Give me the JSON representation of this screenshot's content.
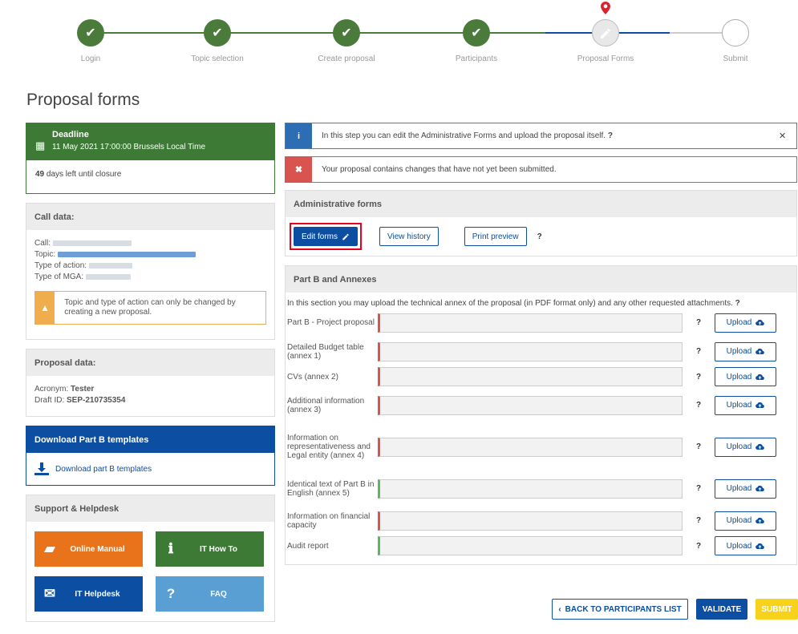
{
  "stepper": {
    "steps": [
      {
        "label": "Login",
        "state": "done"
      },
      {
        "label": "Topic selection",
        "state": "done"
      },
      {
        "label": "Create proposal",
        "state": "done"
      },
      {
        "label": "Participants",
        "state": "done"
      },
      {
        "label": "Proposal Forms",
        "state": "current"
      },
      {
        "label": "Submit",
        "state": "todo"
      }
    ]
  },
  "page_title": "Proposal forms",
  "deadline": {
    "title": "Deadline",
    "date": "11 May 2021 17:00:00 Brussels Local Time",
    "days_count": "49",
    "days_text": "days left until closure"
  },
  "call_data": {
    "title": "Call data:",
    "call_label": "Call:",
    "topic_label": "Topic:",
    "type_action_label": "Type of action:",
    "type_mga_label": "Type of MGA:",
    "warning": "Topic and type of action can only be changed by creating a new proposal."
  },
  "proposal_data": {
    "title": "Proposal data:",
    "acronym_label": "Acronym:",
    "acronym": "Tester",
    "draft_label": "Draft ID:",
    "draft_id": "SEP-210735354"
  },
  "templates": {
    "title": "Download Part B templates",
    "link": "Download part B templates"
  },
  "support": {
    "title": "Support & Helpdesk",
    "buttons": [
      {
        "label": "Online Manual",
        "color": "#e8731a"
      },
      {
        "label": "IT How To",
        "color": "#3d7a36"
      },
      {
        "label": "IT Helpdesk",
        "color": "#0b4ea2"
      },
      {
        "label": "FAQ",
        "color": "#5a9fd4"
      }
    ]
  },
  "alerts": {
    "info": "In this step you can edit the Administrative Forms and upload the proposal itself.",
    "error": "Your proposal contains changes that have not yet been submitted."
  },
  "admin_forms": {
    "title": "Administrative forms",
    "edit": "Edit forms",
    "history": "View history",
    "print": "Print preview"
  },
  "annexes": {
    "title": "Part B and Annexes",
    "intro": "In this section you may upload the technical annex of the proposal (in PDF format only) and any other requested attachments.",
    "upload_label": "Upload",
    "rows": [
      {
        "label": "Part B - Project proposal",
        "status": "#d9534f"
      },
      {
        "label": "Detailed Budget table (annex 1)",
        "status": "#d9534f"
      },
      {
        "label": "CVs (annex 2)",
        "status": "#d9534f"
      },
      {
        "label": "Additional information (annex 3)",
        "status": "#d9534f"
      },
      {
        "label": "Information on representativeness and Legal entity (annex 4)",
        "status": "#d9534f"
      },
      {
        "label": "Identical text of Part B in English (annex 5)",
        "status": "#5cb85c"
      },
      {
        "label": "Information on financial capacity",
        "status": "#d9534f"
      },
      {
        "label": "Audit report",
        "status": "#5cb85c"
      }
    ]
  },
  "footer_buttons": {
    "back": "BACK TO PARTICIPANTS LIST",
    "validate": "VALIDATE",
    "submit": "SUBMIT"
  }
}
